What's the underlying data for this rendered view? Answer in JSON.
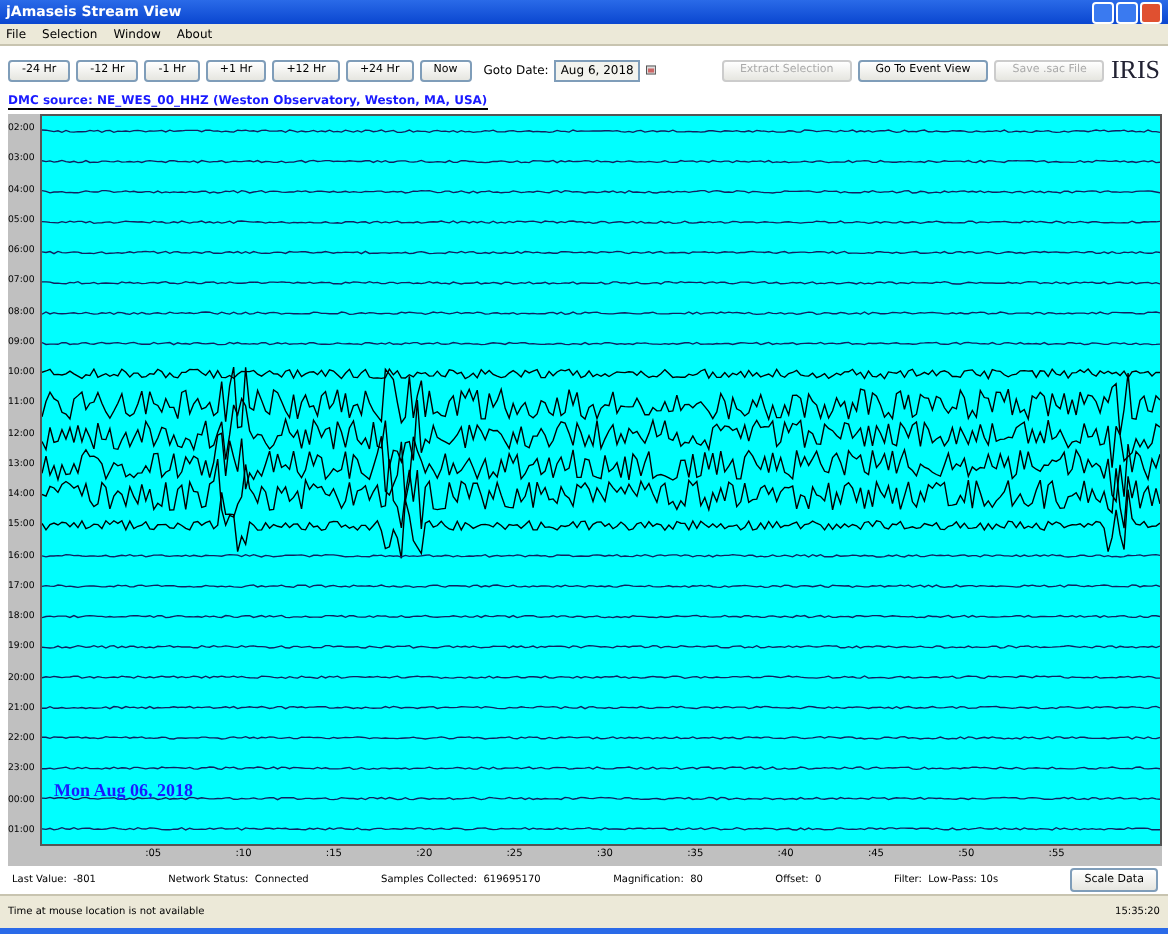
{
  "window": {
    "title": "jAmaseis Stream View"
  },
  "menu": [
    "File",
    "Selection",
    "Window",
    "About"
  ],
  "toolbar": {
    "shift_buttons": [
      "-24 Hr",
      "-12 Hr",
      "-1 Hr",
      "+1 Hr",
      "+12 Hr",
      "+24 Hr",
      "Now"
    ],
    "goto_label": "Goto Date:",
    "goto_value": "Aug 6, 2018",
    "action_buttons": [
      {
        "label": "Extract Selection",
        "disabled": true
      },
      {
        "label": "Go To Event View",
        "disabled": false
      },
      {
        "label": "Save .sac File",
        "disabled": true
      }
    ],
    "logo": "IRIS"
  },
  "plot": {
    "title": "DMC source: NE_WES_00_HHZ (Weston Observatory, Weston, MA, USA)",
    "hours": [
      "02:00",
      "03:00",
      "04:00",
      "05:00",
      "06:00",
      "07:00",
      "08:00",
      "09:00",
      "10:00",
      "11:00",
      "12:00",
      "13:00",
      "14:00",
      "15:00",
      "16:00",
      "17:00",
      "18:00",
      "19:00",
      "20:00",
      "21:00",
      "22:00",
      "23:00",
      "00:00",
      "01:00"
    ],
    "date_label": "Mon Aug 06, 2018",
    "minute_ticks": [
      ":05",
      ":10",
      ":15",
      ":20",
      ":25",
      ":30",
      ":35",
      ":40",
      ":45",
      ":50",
      ":55"
    ]
  },
  "status": [
    {
      "label": "Last Value:",
      "value": "-801"
    },
    {
      "label": "Network Status:",
      "value": "Connected"
    },
    {
      "label": "Samples Collected:",
      "value": "619695170"
    },
    {
      "label": "Magnification:",
      "value": "80"
    },
    {
      "label": "Offset:",
      "value": "0"
    },
    {
      "label": "Filter:",
      "value": "Low-Pass: 10s"
    }
  ],
  "scale_button": "Scale Data",
  "status_bar": {
    "message": "Time at mouse location is not available",
    "time": "15:35:20"
  }
}
